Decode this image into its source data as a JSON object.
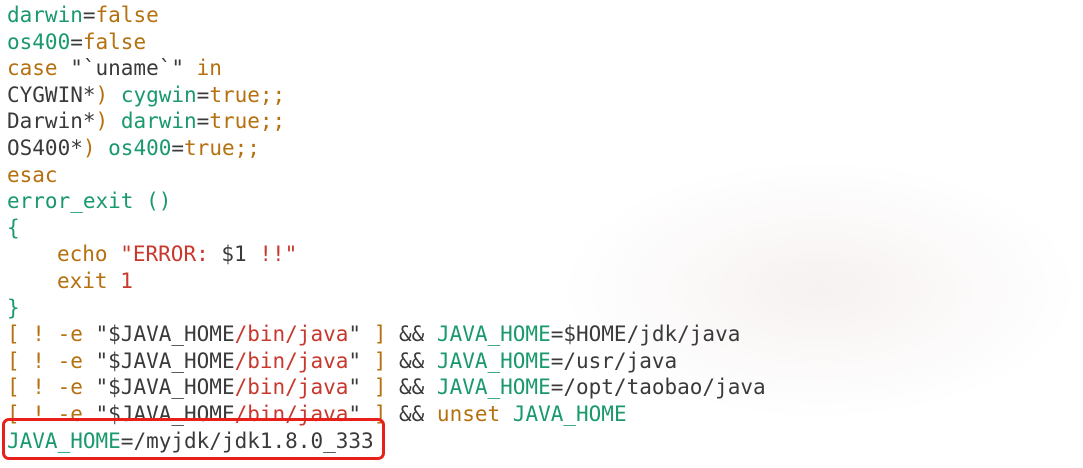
{
  "colors": {
    "var": "#1a9a6c",
    "keyword": "#b5700f",
    "plain": "#3a3a3a",
    "string": "#c8382d",
    "highlight_border": "#e8201a"
  },
  "lines": [
    [
      {
        "t": "darwin",
        "c": "var"
      },
      {
        "t": "=",
        "c": "plain"
      },
      {
        "t": "false",
        "c": "keyword"
      }
    ],
    [
      {
        "t": "os400",
        "c": "var"
      },
      {
        "t": "=",
        "c": "plain"
      },
      {
        "t": "false",
        "c": "keyword"
      }
    ],
    [
      {
        "t": "case",
        "c": "keyword"
      },
      {
        "t": " \"`uname`\" ",
        "c": "plain"
      },
      {
        "t": "in",
        "c": "keyword"
      }
    ],
    [
      {
        "t": "CYGWIN*",
        "c": "plain"
      },
      {
        "t": ") ",
        "c": "keyword"
      },
      {
        "t": "cygwin",
        "c": "var"
      },
      {
        "t": "=",
        "c": "plain"
      },
      {
        "t": "true;;",
        "c": "keyword"
      }
    ],
    [
      {
        "t": "Darwin*",
        "c": "plain"
      },
      {
        "t": ") ",
        "c": "keyword"
      },
      {
        "t": "darwin",
        "c": "var"
      },
      {
        "t": "=",
        "c": "plain"
      },
      {
        "t": "true;;",
        "c": "keyword"
      }
    ],
    [
      {
        "t": "OS400*",
        "c": "plain"
      },
      {
        "t": ") ",
        "c": "keyword"
      },
      {
        "t": "os400",
        "c": "var"
      },
      {
        "t": "=",
        "c": "plain"
      },
      {
        "t": "true;;",
        "c": "keyword"
      }
    ],
    [
      {
        "t": "esac",
        "c": "keyword"
      }
    ],
    [
      {
        "t": "error_exit ()",
        "c": "var"
      }
    ],
    [
      {
        "t": "{",
        "c": "var"
      }
    ],
    [
      {
        "t": "echo",
        "c": "keyword",
        "indent": true
      },
      {
        "t": " ",
        "c": "plain"
      },
      {
        "t": "\"ERROR: ",
        "c": "string"
      },
      {
        "t": "$1",
        "c": "plain"
      },
      {
        "t": " !!\"",
        "c": "string"
      }
    ],
    [
      {
        "t": "exit",
        "c": "keyword",
        "indent": true
      },
      {
        "t": " ",
        "c": "plain"
      },
      {
        "t": "1",
        "c": "string"
      }
    ],
    [
      {
        "t": "}",
        "c": "var"
      }
    ],
    [
      {
        "t": "[ ! -e ",
        "c": "keyword"
      },
      {
        "t": "\"$JAVA_HOME",
        "c": "plain"
      },
      {
        "t": "/bin/java",
        "c": "string"
      },
      {
        "t": "\" ",
        "c": "plain"
      },
      {
        "t": "]",
        "c": "keyword"
      },
      {
        "t": " && ",
        "c": "plain"
      },
      {
        "t": "JAVA_HOME",
        "c": "var"
      },
      {
        "t": "=$HOME/jdk/java",
        "c": "plain"
      }
    ],
    [
      {
        "t": "[ ! -e ",
        "c": "keyword"
      },
      {
        "t": "\"$JAVA_HOME",
        "c": "plain"
      },
      {
        "t": "/bin/java",
        "c": "string"
      },
      {
        "t": "\" ",
        "c": "plain"
      },
      {
        "t": "]",
        "c": "keyword"
      },
      {
        "t": " && ",
        "c": "plain"
      },
      {
        "t": "JAVA_HOME",
        "c": "var"
      },
      {
        "t": "=/usr/java",
        "c": "plain"
      }
    ],
    [
      {
        "t": "[ ! -e ",
        "c": "keyword"
      },
      {
        "t": "\"$JAVA_HOME",
        "c": "plain"
      },
      {
        "t": "/bin/java",
        "c": "string"
      },
      {
        "t": "\" ",
        "c": "plain"
      },
      {
        "t": "]",
        "c": "keyword"
      },
      {
        "t": " && ",
        "c": "plain"
      },
      {
        "t": "JAVA_HOME",
        "c": "var"
      },
      {
        "t": "=/opt/taobao/java",
        "c": "plain"
      }
    ],
    [
      {
        "t": "[ ! -e ",
        "c": "keyword"
      },
      {
        "t": "\"$JAVA_HOME",
        "c": "plain"
      },
      {
        "t": "/bin/java",
        "c": "string"
      },
      {
        "t": "\" ",
        "c": "plain"
      },
      {
        "t": "]",
        "c": "keyword"
      },
      {
        "t": " && ",
        "c": "plain"
      },
      {
        "t": "unset",
        "c": "keyword"
      },
      {
        "t": " ",
        "c": "plain"
      },
      {
        "t": "JAVA_HOME",
        "c": "var"
      }
    ],
    [
      {
        "t": "JAVA_HOME",
        "c": "var"
      },
      {
        "t": "=/myjdk/jdk1.8.0_333",
        "c": "plain"
      }
    ]
  ],
  "highlighted_line_index": 16
}
